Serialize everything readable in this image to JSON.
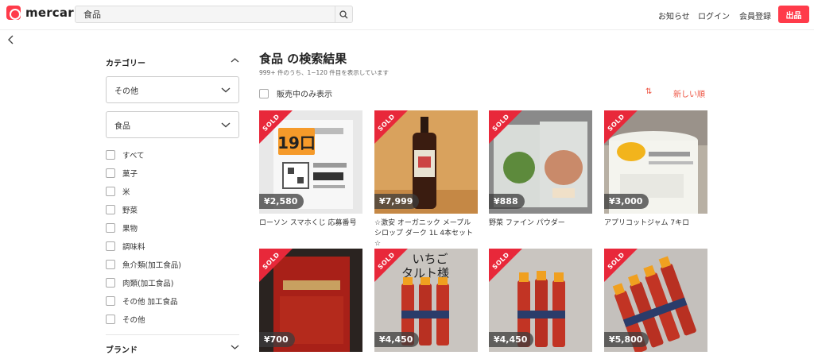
{
  "header": {
    "logo_text": "mercari",
    "search_value": "食品",
    "nav_notice": "お知らせ",
    "nav_login": "ログイン",
    "nav_register": "会員登録",
    "sell_label": "出品"
  },
  "sidebar": {
    "category_title": "カテゴリー",
    "select1": "その他",
    "select2": "食品",
    "checkboxes": [
      "すべて",
      "菓子",
      "米",
      "野菜",
      "果物",
      "調味料",
      "魚介類(加工食品)",
      "肉類(加工食品)",
      "その他 加工食品",
      "その他"
    ],
    "brand_title": "ブランド"
  },
  "main": {
    "title": "食品 の検索結果",
    "subtitle": "999+ 件のうち、1−120 件目を表示しています",
    "onsale_label": "販売中のみ表示",
    "sort_icon": "⇅",
    "sort_label": "新しい順"
  },
  "items": [
    {
      "sold": "SOLD",
      "price": "¥2,580",
      "name": "ローソン スマホくじ 応募番号"
    },
    {
      "sold": "SOLD",
      "price": "¥7,999",
      "name": "☆激安 オーガニック メープルシロップ ダーク 1L 4本セット☆"
    },
    {
      "sold": "SOLD",
      "price": "¥888",
      "name": "野菜 ファイン パウダー"
    },
    {
      "sold": "SOLD",
      "price": "¥3,000",
      "name": "アプリコットジャム 7キロ"
    },
    {
      "sold": "SOLD",
      "price": "¥700",
      "name": ""
    },
    {
      "sold": "SOLD",
      "price": "¥4,450",
      "name": ""
    },
    {
      "sold": "SOLD",
      "price": "¥4,450",
      "name": ""
    },
    {
      "sold": "SOLD",
      "price": "¥5,800",
      "name": ""
    }
  ],
  "photo_text": {
    "lottery_number": "19口",
    "ichigo_line1": "いちご",
    "ichigo_line2": "タルト様"
  },
  "colors": {
    "brand_red": "#ff3b4a",
    "sold_red": "#e8283a",
    "sort_red": "#e54"
  }
}
